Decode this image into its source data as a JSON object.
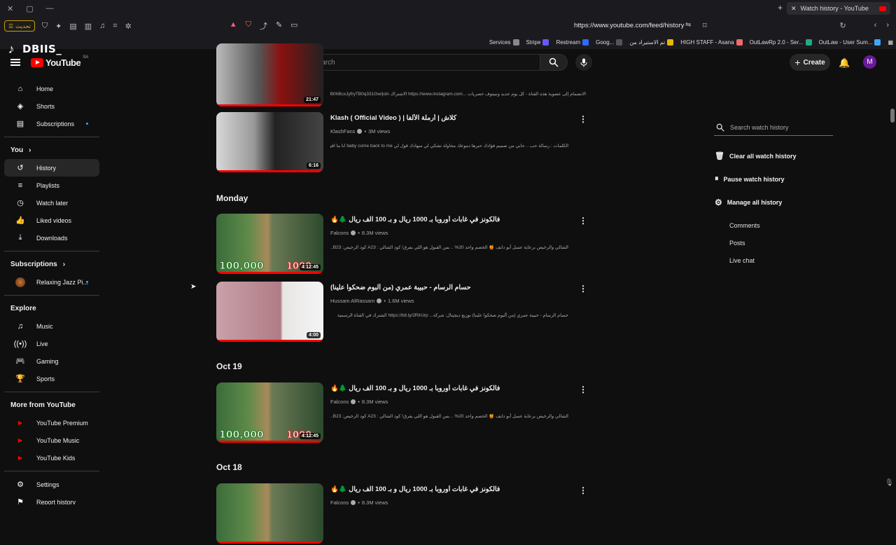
{
  "browser": {
    "tab_title": "Watch history - YouTube",
    "url": "https://www.youtube.com/feed/history",
    "update_label": "تحديث",
    "bookmarks": [
      {
        "label": "Services",
        "color": "#888888"
      },
      {
        "label": "Stripe",
        "color": "#635bff"
      },
      {
        "label": "Restream",
        "color": "#2f6bff"
      },
      {
        "label": "Goog...",
        "color": "#555555"
      },
      {
        "label": "تم الاستيراد من",
        "color": "#e6b800"
      },
      {
        "label": "HIGH STAFF - Asana",
        "color": "#f06a6a"
      },
      {
        "label": "OutLawRp 2.0 - Ser...",
        "color": "#22aa88"
      },
      {
        "label": "OutLaw - User Sum...",
        "color": "#3ea6ff"
      }
    ]
  },
  "overlay": {
    "tiktok_name": "DBIIS_"
  },
  "header": {
    "logo_text": "YouTube",
    "country": "SA",
    "search_placeholder": "Search",
    "create_label": "Create",
    "avatar_letter": "M"
  },
  "sidebar": {
    "top": [
      {
        "label": "Home",
        "icon": "⌂"
      },
      {
        "label": "Shorts",
        "icon": "◈"
      },
      {
        "label": "Subscriptions",
        "icon": "▤"
      }
    ],
    "you_label": "You",
    "you": [
      {
        "label": "History",
        "icon": "↺"
      },
      {
        "label": "Playlists",
        "icon": "≡"
      },
      {
        "label": "Watch later",
        "icon": "◷"
      },
      {
        "label": "Liked videos",
        "icon": "👍"
      },
      {
        "label": "Downloads",
        "icon": "⤓"
      }
    ],
    "subs_label": "Subscriptions",
    "subs": [
      {
        "label": "Relaxing Jazz Pi..."
      }
    ],
    "explore_label": "Explore",
    "explore": [
      {
        "label": "Music",
        "icon": "♫"
      },
      {
        "label": "Live",
        "icon": "((•))"
      },
      {
        "label": "Gaming",
        "icon": "🎮"
      },
      {
        "label": "Sports",
        "icon": "🏆"
      }
    ],
    "more_label": "More from YouTube",
    "more": [
      {
        "label": "YouTube Premium"
      },
      {
        "label": "YouTube Music"
      },
      {
        "label": "YouTube Kids"
      }
    ],
    "settings_label": "Settings",
    "report_label": "Report history"
  },
  "feed": {
    "partial_top": {
      "duration": "21:47",
      "desc": "الانضمام إلى عضوية هذه القناة - كل يوم جديد ونبيتوف حصريات ...https://www.instagram.com الاشتراك https://www.youtube.com/channel/UCXXB0hBcxJyfryTB0q331Gw/join"
    },
    "videos": [
      {
        "title": "Klash ( Official Video ) | كلاش | أرملة الألفا",
        "channel": "KlashFans",
        "views": "3M views",
        "desc": "الكلمات : رسالة حب .. جاني من صميم فؤادك حبرها دموعك محاولة تشكي لي سهادك قول لي baby come back to me انا ما اقوى...",
        "duration": "6:16"
      }
    ],
    "days": [
      {
        "label": "Monday",
        "videos": [
          {
            "title": "فالكونز في غابات أوروبا بـ 1000 ريال و بـ 100 الف ريال 🌲🔥",
            "channel": "Falcons",
            "views": "8.3M views",
            "desc": "الشالي والرخيص برعاية عسل أبو دايف 🍯 الخصم واحد 20% .. بس القبول هو اللي يفرق! كود الشالي : A23 كود الرخيص: B23...",
            "duration": "4:12:45",
            "thumb_big": "100,000",
            "thumb_big2": "1000"
          },
          {
            "title": "حسام الرسام - حبيبة عمري (من ألبوم ضحكوا علينا)",
            "channel": "Hussam AlRassam",
            "views": "1.6M views",
            "desc": "حسام الرسام - حبيبة عمري (من ألبوم ضحكوا علينا) توزيع ديجيتال: شركة... https://bit.ly/2RlrUrp الشترك في القناة الرسمية",
            "duration": "4:00"
          }
        ]
      },
      {
        "label": "Oct 19",
        "videos": [
          {
            "title": "فالكونز في غابات أوروبا بـ 1000 ريال و بـ 100 الف ريال 🌲🔥",
            "channel": "Falcons",
            "views": "8.3M views",
            "desc": "الشالي والرخيص برعاية عسل أبو دايف 🍯 الخصم واحد 20% .. بس القبول هو اللي يفرق! كود الشالي : A23 كود الرخيص: B23...",
            "duration": "4:12:45",
            "thumb_big": "100,000",
            "thumb_big2": "1000"
          }
        ]
      },
      {
        "label": "Oct 18",
        "videos": [
          {
            "title": "فالكونز في غابات أوروبا بـ 1000 ريال و بـ 100 الف ريال 🌲🔥",
            "channel": "Falcons",
            "views": "8.3M views"
          }
        ]
      }
    ]
  },
  "right_panel": {
    "search_placeholder": "Search watch history",
    "clear_label": "Clear all watch history",
    "pause_label": "Pause watch history",
    "manage_label": "Manage all history",
    "sub_items": [
      "Comments",
      "Posts",
      "Live chat"
    ]
  }
}
